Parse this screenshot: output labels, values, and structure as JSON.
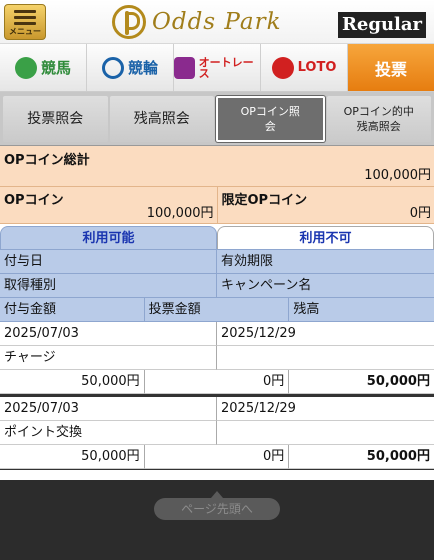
{
  "header": {
    "menu_label": "メニュー",
    "logo_text": "Odds Park",
    "membership": "Regular"
  },
  "categories": [
    {
      "label": "競馬"
    },
    {
      "label": "競輪"
    },
    {
      "label": "オートレース"
    },
    {
      "label": "LOTO"
    },
    {
      "label": "投票"
    }
  ],
  "subtabs": [
    {
      "label": "投票照会"
    },
    {
      "label": "残高照会"
    },
    {
      "label": "OPコイン照会"
    },
    {
      "label": "OPコイン的中残高照会"
    }
  ],
  "summary": {
    "total_label": "OPコイン総計",
    "total_value": "100,000円",
    "coin_label": "OPコイン",
    "coin_value": "100,000円",
    "limited_label": "限定OPコイン",
    "limited_value": "0円"
  },
  "availability_tabs": {
    "available": "利用可能",
    "unavailable": "利用不可"
  },
  "table_headers": {
    "grant_date": "付与日",
    "expiry": "有効期限",
    "acquisition_type": "取得種別",
    "campaign_name": "キャンペーン名",
    "grant_amount": "付与金額",
    "bet_amount": "投票金額",
    "balance": "残高"
  },
  "records": [
    {
      "grant_date": "2025/07/03",
      "expiry": "2025/12/29",
      "acquisition_type": "チャージ",
      "campaign_name": "",
      "grant_amount": "50,000円",
      "bet_amount": "0円",
      "balance": "50,000円"
    },
    {
      "grant_date": "2025/07/03",
      "expiry": "2025/12/29",
      "acquisition_type": "ポイント交換",
      "campaign_name": "",
      "grant_amount": "50,000円",
      "bet_amount": "0円",
      "balance": "50,000円"
    }
  ],
  "footer": {
    "page_top": "ページ先頭へ"
  }
}
